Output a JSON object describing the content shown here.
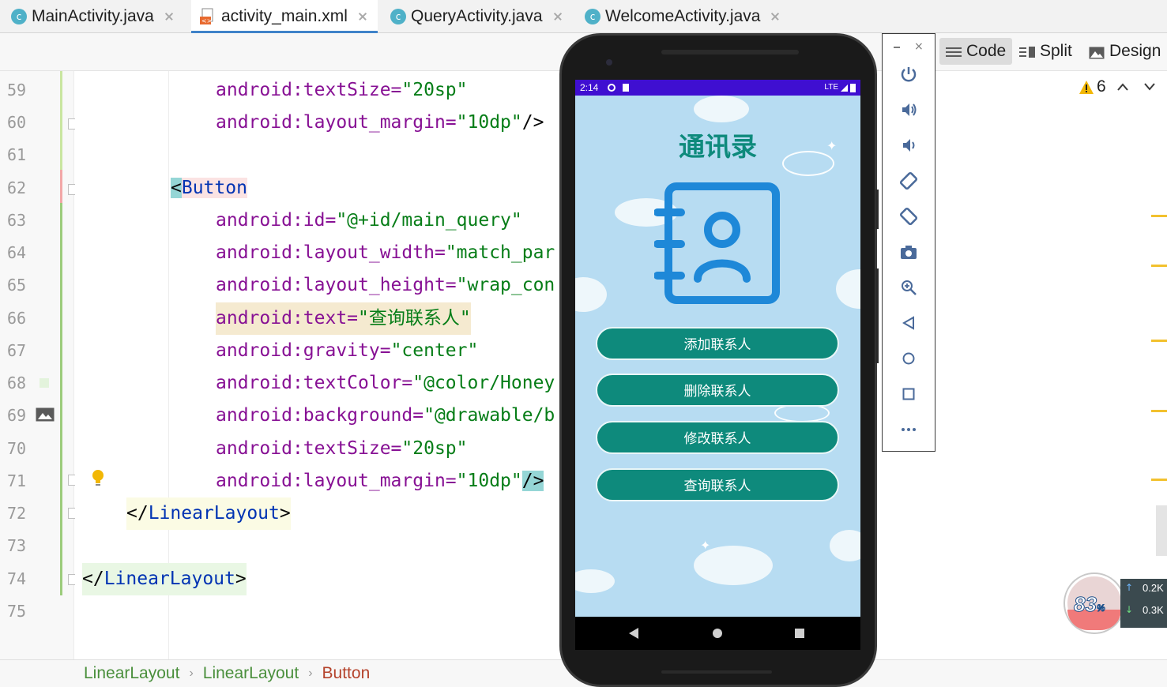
{
  "tabs": [
    {
      "label": "MainActivity.java",
      "icon": "c-class-icon"
    },
    {
      "label": "activity_main.xml",
      "icon": "xml-file-icon",
      "active": true
    },
    {
      "label": "QueryActivity.java",
      "icon": "c-class-icon"
    },
    {
      "label": "WelcomeActivity.java",
      "icon": "c-class-icon"
    }
  ],
  "tab_class_glyph": "c",
  "view_modes": {
    "code": "Code",
    "split": "Split",
    "design": "Design",
    "active": "Code"
  },
  "inspections": {
    "warning_count": "6"
  },
  "line_numbers": [
    "59",
    "60",
    "61",
    "62",
    "63",
    "64",
    "65",
    "66",
    "67",
    "68",
    "69",
    "70",
    "71",
    "72",
    "73",
    "74",
    "75"
  ],
  "code_lines": {
    "l59_ns": "android",
    "l59_attr": ":textSize=",
    "l59_val": "\"20sp\"",
    "l60_ns": "android",
    "l60_attr": ":layout_margin=",
    "l60_val": "\"10dp\"",
    "l60_end": "/>",
    "l62_open": "<",
    "l62_tag": "Button",
    "l63_ns": "android",
    "l63_attr": ":id=",
    "l63_val": "\"@+id/main_query\"",
    "l64_ns": "android",
    "l64_attr": ":layout_width=",
    "l64_val": "\"match_par",
    "l65_ns": "android",
    "l65_attr": ":layout_height=",
    "l65_val": "\"wrap_con",
    "l66_ns": "android",
    "l66_attr": ":text=",
    "l66_val": "\"查询联系人\"",
    "l67_ns": "android",
    "l67_attr": ":gravity=",
    "l67_val": "\"center\"",
    "l68_ns": "android",
    "l68_attr": ":textColor=",
    "l68_val": "\"@color/Honey",
    "l69_ns": "android",
    "l69_attr": ":background=",
    "l69_val": "\"@drawable/b",
    "l70_ns": "android",
    "l70_attr": ":textSize=",
    "l70_val": "\"20sp\"",
    "l71_ns": "android",
    "l71_attr": ":layout_margin=",
    "l71_val": "\"10dp\"",
    "l71_end": "/>",
    "l72_open": "</",
    "l72_tag": "LinearLayout",
    "l72_close": ">",
    "l74_open": "</",
    "l74_tag": "LinearLayout",
    "l74_close": ">"
  },
  "breadcrumb": [
    "LinearLayout",
    "LinearLayout",
    "Button"
  ],
  "emulator": {
    "status_time": "2:14",
    "status_right": "LTE",
    "app_title": "通讯录",
    "buttons": [
      "添加联系人",
      "删除联系人",
      "修改联系人",
      "查询联系人"
    ],
    "colors": {
      "app_bg": "#b7dcf2",
      "button": "#0e8a7c",
      "statusbar": "#3f0fd1",
      "icon": "#1e88d8"
    }
  },
  "emulator_controls": [
    "power-icon",
    "volume-up-icon",
    "volume-down-icon",
    "rotate-left-icon",
    "rotate-right-icon",
    "screenshot-icon",
    "zoom-icon",
    "back-icon",
    "home-icon",
    "overview-icon",
    "more-icon"
  ],
  "net_widget": {
    "percent": "83",
    "percent_unit": "%",
    "up": "0.2",
    "down": "0.3",
    "unit": "K"
  }
}
